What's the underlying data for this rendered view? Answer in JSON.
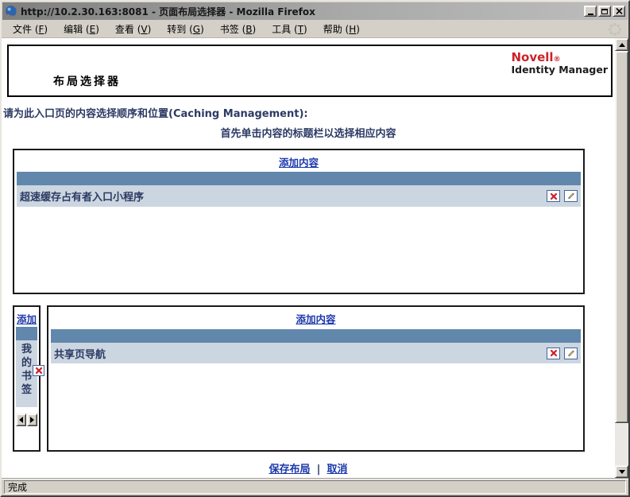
{
  "window": {
    "title": "http://10.2.30.163:8081 - 页面布局选择器 - Mozilla Firefox",
    "status_text": "完成"
  },
  "menu": {
    "items": [
      {
        "pre": "文件 (",
        "accel": "F",
        "post": ")"
      },
      {
        "pre": "编辑 (",
        "accel": "E",
        "post": ")"
      },
      {
        "pre": "查看 (",
        "accel": "V",
        "post": ")"
      },
      {
        "pre": "转到 (",
        "accel": "G",
        "post": ")"
      },
      {
        "pre": "书签 (",
        "accel": "B",
        "post": ")"
      },
      {
        "pre": "工具 (",
        "accel": "T",
        "post": ")"
      },
      {
        "pre": "帮助 (",
        "accel": "H",
        "post": ")"
      }
    ]
  },
  "branding": {
    "brand": "Novell",
    "registered": "®",
    "product": "Identity Manager"
  },
  "page": {
    "heading": "布局选择器",
    "instruction_main": "请为此入口页的内容选择顺序和位置(Caching Management):",
    "instruction_sub": "首先单击内容的标题栏以选择相应内容",
    "panel_top": {
      "add_link": "添加内容",
      "item": "超速缓存占有者入口小程序"
    },
    "panel_left": {
      "add_link": "添加",
      "item_vertical": "我的书签"
    },
    "panel_bottom": {
      "add_link": "添加内容",
      "item": "共享页导航"
    },
    "footer": {
      "save_link": "保存布局",
      "separator": "|",
      "cancel_link": "取消"
    }
  },
  "colors": {
    "novell_red": "#cc2229",
    "link_blue": "#1c38ac",
    "panel_bar_blue": "#6187ac",
    "item_row_bg": "#cbd6e0",
    "text_navy": "#2c3a64",
    "delete_red": "#cc2026",
    "chrome_grey": "#d4d0c8"
  }
}
